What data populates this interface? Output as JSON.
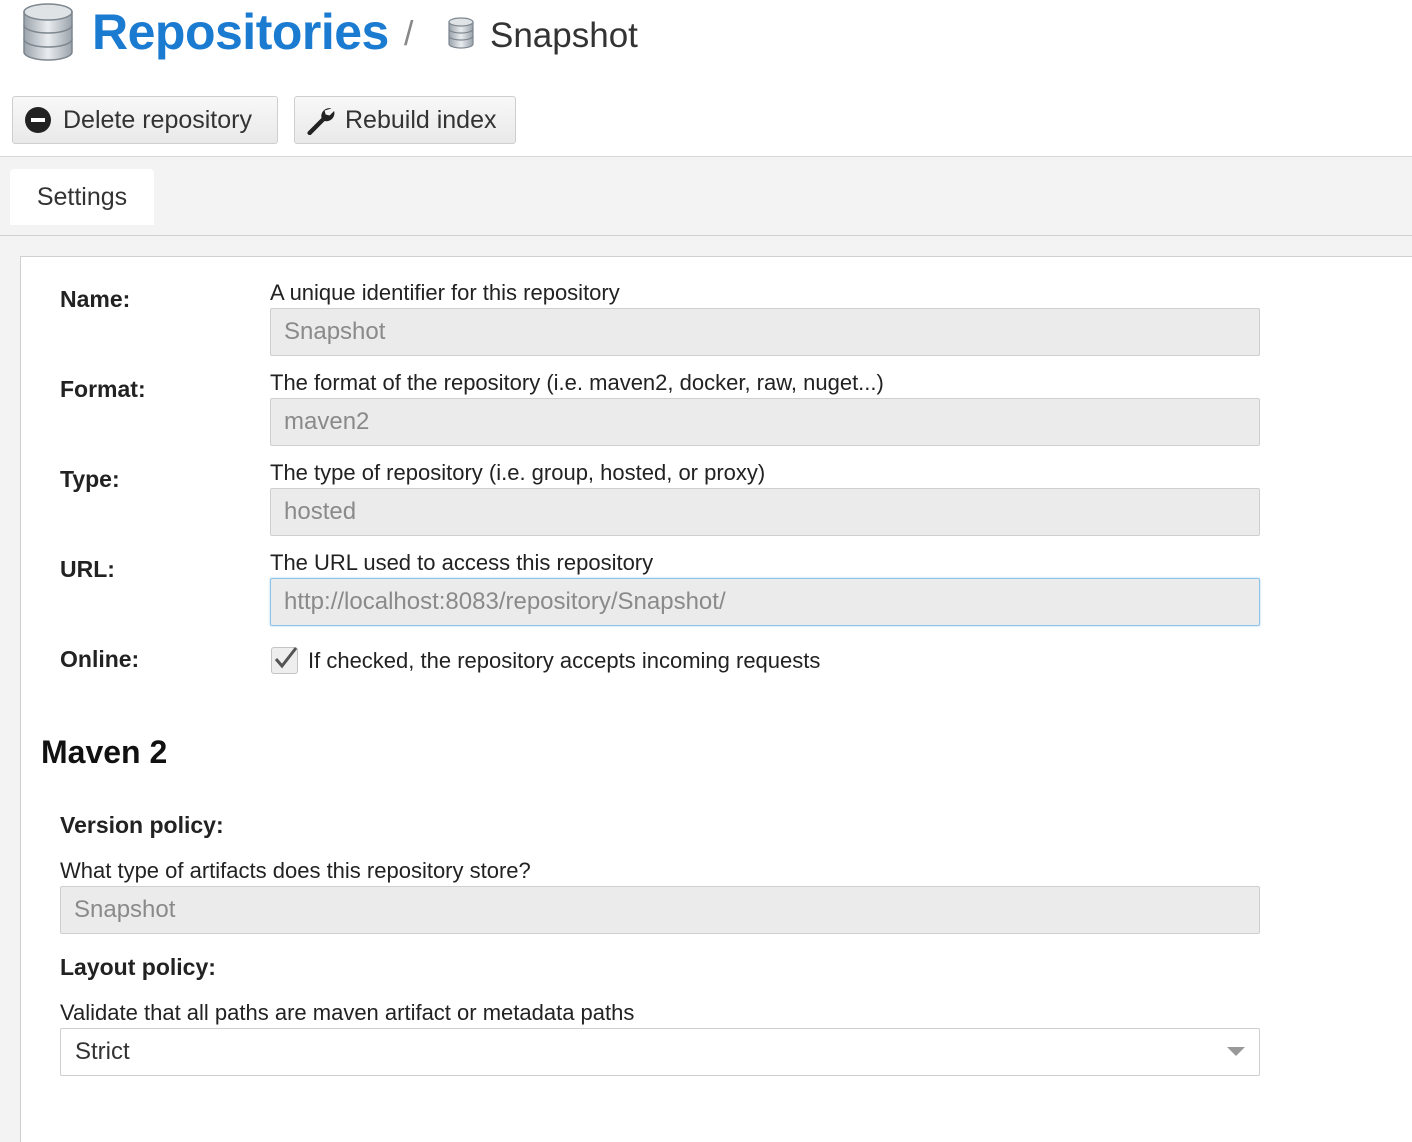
{
  "breadcrumb": {
    "root": "Repositories",
    "separator": "/",
    "current": "Snapshot",
    "root_icon": "database-icon",
    "current_icon": "database-icon"
  },
  "toolbar": {
    "delete_label": "Delete repository",
    "delete_icon": "minus-circle-icon",
    "rebuild_label": "Rebuild index",
    "rebuild_icon": "wrench-icon"
  },
  "tabs": [
    {
      "label": "Settings",
      "active": true
    }
  ],
  "form": {
    "name": {
      "label": "Name:",
      "help": "A unique identifier for this repository",
      "value": "Snapshot"
    },
    "format": {
      "label": "Format:",
      "help": "The format of the repository (i.e. maven2, docker, raw, nuget...)",
      "value": "maven2"
    },
    "type": {
      "label": "Type:",
      "help": "The type of repository (i.e. group, hosted, or proxy)",
      "value": "hosted"
    },
    "url": {
      "label": "URL:",
      "help": "The URL used to access this repository",
      "value": "http://localhost:8083/repository/Snapshot/"
    },
    "online": {
      "label": "Online:",
      "help": "If checked, the repository accepts incoming requests",
      "checked": true
    }
  },
  "maven": {
    "title": "Maven 2",
    "version_policy": {
      "label": "Version policy:",
      "help": "What type of artifacts does this repository store?",
      "value": "Snapshot"
    },
    "layout_policy": {
      "label": "Layout policy:",
      "help": "Validate that all paths are maven artifact or metadata paths",
      "value": "Strict"
    }
  },
  "colors": {
    "accent": "#1a7bd1",
    "field_bg": "#ebebeb",
    "focus_border": "#8ec3ea"
  }
}
